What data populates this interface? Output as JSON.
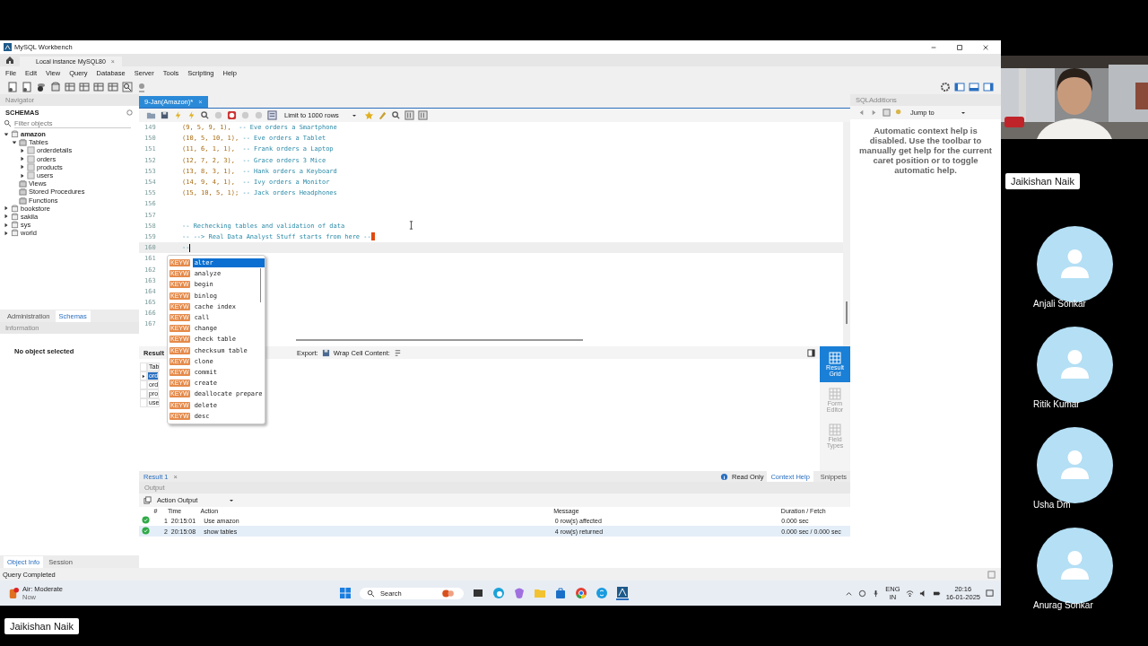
{
  "window": {
    "title": "MySQL Workbench"
  },
  "connection_tab": {
    "label": "Local instance MySQL80",
    "close": "×"
  },
  "menu": [
    "File",
    "Edit",
    "View",
    "Query",
    "Database",
    "Server",
    "Tools",
    "Scripting",
    "Help"
  ],
  "navigator": {
    "title": "Navigator",
    "section": "SCHEMAS",
    "filter_placeholder": "Filter objects",
    "tree": [
      {
        "label": "amazon",
        "kind": "schema",
        "expanded": true,
        "active": true,
        "children": [
          {
            "label": "Tables",
            "kind": "folder",
            "expanded": true,
            "children": [
              {
                "label": "orderdetails",
                "kind": "table",
                "expanded": false
              },
              {
                "label": "orders",
                "kind": "table",
                "expanded": false
              },
              {
                "label": "products",
                "kind": "table",
                "expanded": false
              },
              {
                "label": "users",
                "kind": "table",
                "expanded": false
              }
            ]
          },
          {
            "label": "Views",
            "kind": "folder"
          },
          {
            "label": "Stored Procedures",
            "kind": "folder"
          },
          {
            "label": "Functions",
            "kind": "folder"
          }
        ]
      },
      {
        "label": "bookstore",
        "kind": "schema",
        "expanded": false,
        "active": false
      },
      {
        "label": "sakila",
        "kind": "schema",
        "expanded": false,
        "active": false
      },
      {
        "label": "sys",
        "kind": "schema",
        "expanded": false,
        "active": false
      },
      {
        "label": "world",
        "kind": "schema",
        "expanded": false,
        "active": false
      }
    ]
  },
  "panel_tabs": [
    {
      "label": "Administration",
      "selected": false
    },
    {
      "label": "Schemas",
      "selected": true
    }
  ],
  "information": {
    "title": "Information",
    "text": "No object selected"
  },
  "info_tabs": [
    {
      "label": "Object Info",
      "selected": true
    },
    {
      "label": "Session",
      "selected": false
    }
  ],
  "editor": {
    "tab": "9-Jan(Amazon)*",
    "close": "×",
    "limit": "Limit to 1000 rows",
    "lines": [
      {
        "number": "149",
        "values": "(9, 5, 9, 1),  ",
        "comment": "-- Eve orders a Smartphone"
      },
      {
        "number": "150",
        "values": "(10, 5, 10, 1), ",
        "comment": "-- Eve orders a Tablet"
      },
      {
        "number": "151",
        "values": "(11, 6, 1, 1),  ",
        "comment": "-- Frank orders a Laptop"
      },
      {
        "number": "152",
        "values": "(12, 7, 2, 3),  ",
        "comment": "-- Grace orders 3 Mice"
      },
      {
        "number": "153",
        "values": "(13, 8, 3, 1),  ",
        "comment": "-- Hank orders a Keyboard"
      },
      {
        "number": "154",
        "values": "(14, 9, 4, 1),  ",
        "comment": "-- Ivy orders a Monitor"
      },
      {
        "number": "155",
        "values": "(15, 10, 5, 1); ",
        "comment": "-- Jack orders Headphones"
      },
      {
        "number": "156"
      },
      {
        "number": "157"
      },
      {
        "number": "158",
        "comment": "-- Rechecking tables and validation of data"
      },
      {
        "number": "159",
        "comment": "-- --> Real Data Analyst Stuff starts from here --",
        "error": true
      },
      {
        "number": "160",
        "comment": "--",
        "current": true
      },
      {
        "number": "161"
      },
      {
        "number": "162"
      },
      {
        "number": "163"
      },
      {
        "number": "164"
      },
      {
        "number": "165"
      },
      {
        "number": "166"
      },
      {
        "number": "167"
      }
    ]
  },
  "autocomplete": [
    {
      "badge": "KEYW",
      "label": "alter",
      "selected": true
    },
    {
      "badge": "KEYW",
      "label": "analyze",
      "selected": false
    },
    {
      "badge": "KEYW",
      "label": "begin",
      "selected": false
    },
    {
      "badge": "KEYW",
      "label": "binlog",
      "selected": false
    },
    {
      "badge": "KEYW",
      "label": "cache index",
      "selected": false
    },
    {
      "badge": "KEYW",
      "label": "call",
      "selected": false
    },
    {
      "badge": "KEYW",
      "label": "change",
      "selected": false
    },
    {
      "badge": "KEYW",
      "label": "check table",
      "selected": false
    },
    {
      "badge": "KEYW",
      "label": "checksum table",
      "selected": false
    },
    {
      "badge": "KEYW",
      "label": "clone",
      "selected": false
    },
    {
      "badge": "KEYW",
      "label": "commit",
      "selected": false
    },
    {
      "badge": "KEYW",
      "label": "create",
      "selected": false
    },
    {
      "badge": "KEYW",
      "label": "deallocate prepare",
      "selected": false
    },
    {
      "badge": "KEYW",
      "label": "delete",
      "selected": false
    },
    {
      "badge": "KEYW",
      "label": "desc",
      "selected": false
    }
  ],
  "result": {
    "label": "Result",
    "export": "Export:",
    "wrap": "Wrap Cell Content:",
    "header": "Tab",
    "rows": [
      {
        "text": "ord",
        "selected": true
      },
      {
        "text": "ord",
        "selected": false
      },
      {
        "text": "pro",
        "selected": false
      },
      {
        "text": "use",
        "selected": false
      }
    ],
    "side_tabs": [
      {
        "label": "Result Grid",
        "selected": true
      },
      {
        "label": "Form Editor",
        "selected": false
      },
      {
        "label": "Field Types",
        "selected": false
      }
    ]
  },
  "result_tabs": {
    "tab": "Result 1",
    "close": "×",
    "read_only": "Read Only",
    "right_tabs": [
      {
        "label": "Context Help",
        "selected": true
      },
      {
        "label": "Snippets",
        "selected": false
      }
    ]
  },
  "sql_additions": {
    "title": "SQLAdditions",
    "jump": "Jump to",
    "help": "Automatic context help is disabled. Use the toolbar to manually get help for the current caret position or to toggle automatic help."
  },
  "output": {
    "title": "Output",
    "mode": "Action Output",
    "columns": [
      "#",
      "Time",
      "Action",
      "Message",
      "Duration / Fetch"
    ],
    "rows": [
      {
        "kind": "success",
        "number": "1",
        "time": "20:15:01",
        "action": "Use amazon",
        "message": "0 row(s) affected",
        "duration": "0.000 sec",
        "selected": false
      },
      {
        "kind": "success",
        "number": "2",
        "time": "20:15:08",
        "action": "show tables",
        "message": "4 row(s) returned",
        "duration": "0.000 sec / 0.000 sec",
        "selected": true
      }
    ]
  },
  "status_bar": "Query Completed",
  "taskbar": {
    "weather": "Air: Moderate",
    "weather_sub": "Now",
    "search": "Search",
    "language": [
      "ENG",
      "IN"
    ],
    "time": "20:16",
    "date": "16-01-2025"
  },
  "call": {
    "self_name": "Jaikishan Naik",
    "participants": [
      {
        "name": "Anjali Sonkar"
      },
      {
        "name": "Ritik Kumar"
      },
      {
        "name": "Usha Dm"
      },
      {
        "name": "Anurag Sonkar"
      }
    ],
    "presenter": "Jaikishan Naik"
  }
}
